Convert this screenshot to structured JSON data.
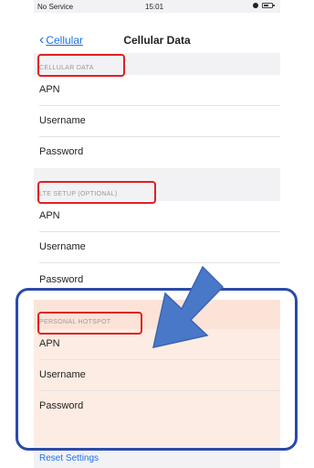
{
  "status_bar": {
    "carrier": "No Service",
    "time": "15:01"
  },
  "nav": {
    "back_label": "Cellular",
    "title": "Cellular Data"
  },
  "sections": {
    "cellular_data": {
      "header": "CELLULAR DATA",
      "rows": [
        "APN",
        "Username",
        "Password"
      ]
    },
    "lte_setup": {
      "header": "LTE SETUP (OPTIONAL)",
      "rows": [
        "APN",
        "Username",
        "Password"
      ]
    },
    "personal_hotspot": {
      "header": "PERSONAL HOTSPOT",
      "rows": [
        "APN",
        "Username",
        "Password"
      ]
    }
  },
  "reset_label": "Reset Settings",
  "colors": {
    "accent": "#1a73e8",
    "highlight_red": "#e02020",
    "callout_blue": "#2b4aa8",
    "arrow_blue": "#4a78c8",
    "hotspot_tint": "#fdece3"
  }
}
